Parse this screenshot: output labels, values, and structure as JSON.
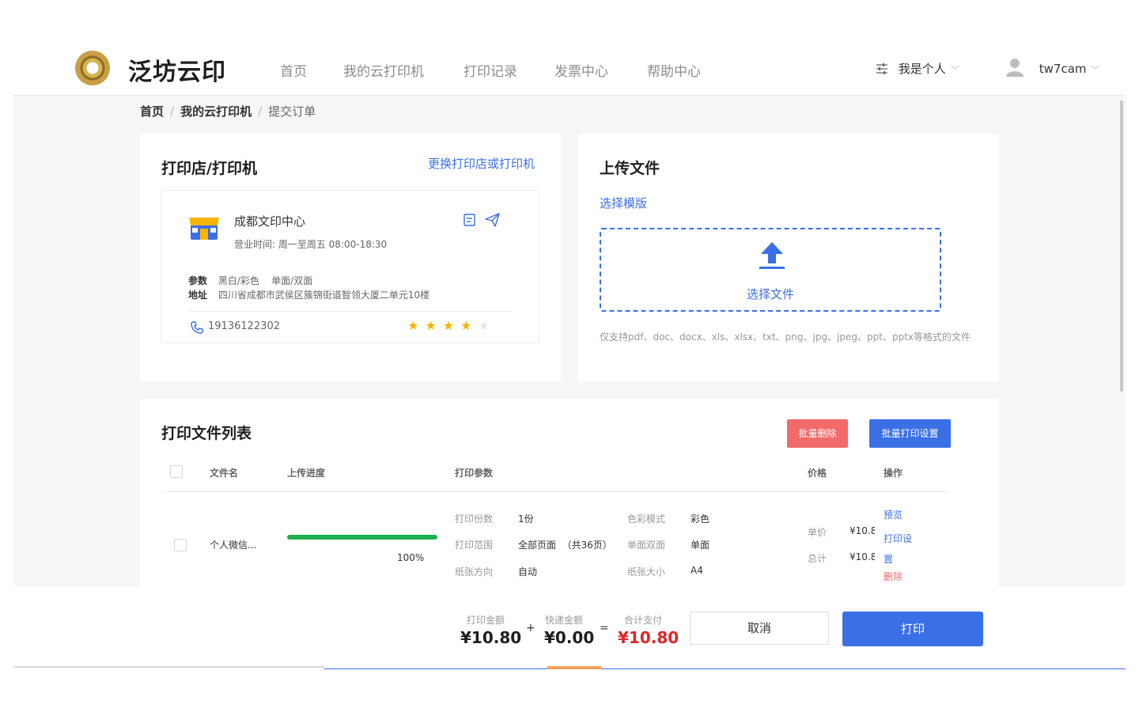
{
  "brand": {
    "name": "泛坊云印"
  },
  "nav": {
    "items": [
      "首页",
      "我的云打印机",
      "打印记录",
      "发票中心",
      "帮助中心"
    ],
    "identity": "我是个人",
    "username": "tw7cam"
  },
  "breadcrumb": [
    "首页",
    "我的云打印机",
    "提交订单"
  ],
  "printer_card": {
    "title": "打印店/打印机",
    "change_link": "更换打印店或打印机",
    "shop_name": "成都文印中心",
    "hours": "营业时间:  周一至周五 08:00-18:30",
    "params_label": "参数",
    "params_value": "黑白/彩色    单面/双面",
    "address_label": "地址",
    "address_value": "四川省成都市武侯区簇锦街道智领大厦二单元10楼",
    "phone": "19136122302",
    "rating": 4,
    "rating_max": 5
  },
  "upload": {
    "title": "上传文件",
    "template_link": "选择模版",
    "select_file": "选择文件",
    "hint": "仅支持pdf、doc、docx、xls、xlsx、txt、png、jpg、jpeg、ppt、pptx等格式的文件"
  },
  "file_list": {
    "title": "打印文件列表",
    "batch_delete": "批量删除",
    "batch_settings": "批量打印设置",
    "headers": {
      "name": "文件名",
      "progress": "上传进度",
      "params": "打印参数",
      "price": "价格",
      "ops": "操作"
    },
    "row": {
      "name": "个人微信...",
      "progress_pct": 100,
      "progress_text": "100%",
      "copies_label": "打印份数",
      "copies": "1份",
      "color_label": "色彩模式",
      "color": "彩色",
      "range_label": "打印范围",
      "range": "全部页面  （共36页）",
      "duplex_label": "单面双面",
      "duplex": "单面",
      "orient_label": "纸张方向",
      "orient": "自动",
      "size_label": "纸张大小",
      "size": "A4",
      "unit_label": "单价",
      "unit_price": "¥10.8",
      "total_label": "总计",
      "total_price": "¥10.8",
      "op_preview": "预览",
      "op_settings": "打印设置",
      "op_delete": "删除"
    }
  },
  "footer": {
    "print_amount_label": "打印金额",
    "print_amount": "¥10.80",
    "plus": "+",
    "shipping_label": "快递金额",
    "shipping": "¥0.00",
    "equals": "=",
    "total_label": "合计支付",
    "total": "¥10.80",
    "cancel": "取消",
    "print": "打印"
  },
  "colors": {
    "accent": "#3b6fe6",
    "danger": "#f26a6a",
    "success": "#1dae4d",
    "price_red": "#e22626"
  }
}
